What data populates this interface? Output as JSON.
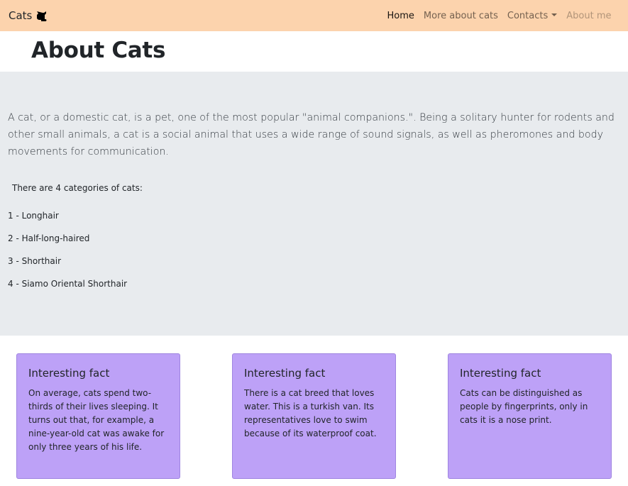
{
  "navbar": {
    "brand": "Cats",
    "brand_icon": "cat-icon",
    "links": [
      {
        "label": "Home",
        "state": "active"
      },
      {
        "label": "More about cats",
        "state": "normal"
      },
      {
        "label": "Contacts",
        "state": "normal",
        "dropdown": true
      },
      {
        "label": "About me",
        "state": "disabled"
      }
    ],
    "background": "#fcd3ad"
  },
  "page_title": "About Cats",
  "jumbotron": {
    "lead": "A cat, or a domestic cat, is a pet, one of the most popular \"animal companions.\". Being a solitary hunter for rodents and other small animals, a cat is a social animal that uses a wide range of sound signals, as well as pheromones and body movements for communication.",
    "intro": "There are 4 categories of cats:",
    "categories": [
      "1 - Longhair",
      "2 - Half-long-haired",
      "3 - Shorthair",
      "4 - Siamo Oriental Shorthair"
    ],
    "background": "#e8ebee"
  },
  "cards": [
    {
      "title": "Interesting fact",
      "text": "On average, cats spend two-thirds of their lives sleeping. It turns out that, for example, a nine-year-old cat was awake for only three years of his life."
    },
    {
      "title": "Interesting fact",
      "text": "There is a cat breed that loves water. This is a turkish van. Its representatives love to swim because of its waterproof coat."
    },
    {
      "title": "Interesting fact",
      "text": "Cats can be distinguished as people by fingerprints, only in cats it is a nose print."
    }
  ],
  "colors": {
    "card_background": "#bda1f7",
    "card_border": "#9f85e0"
  }
}
